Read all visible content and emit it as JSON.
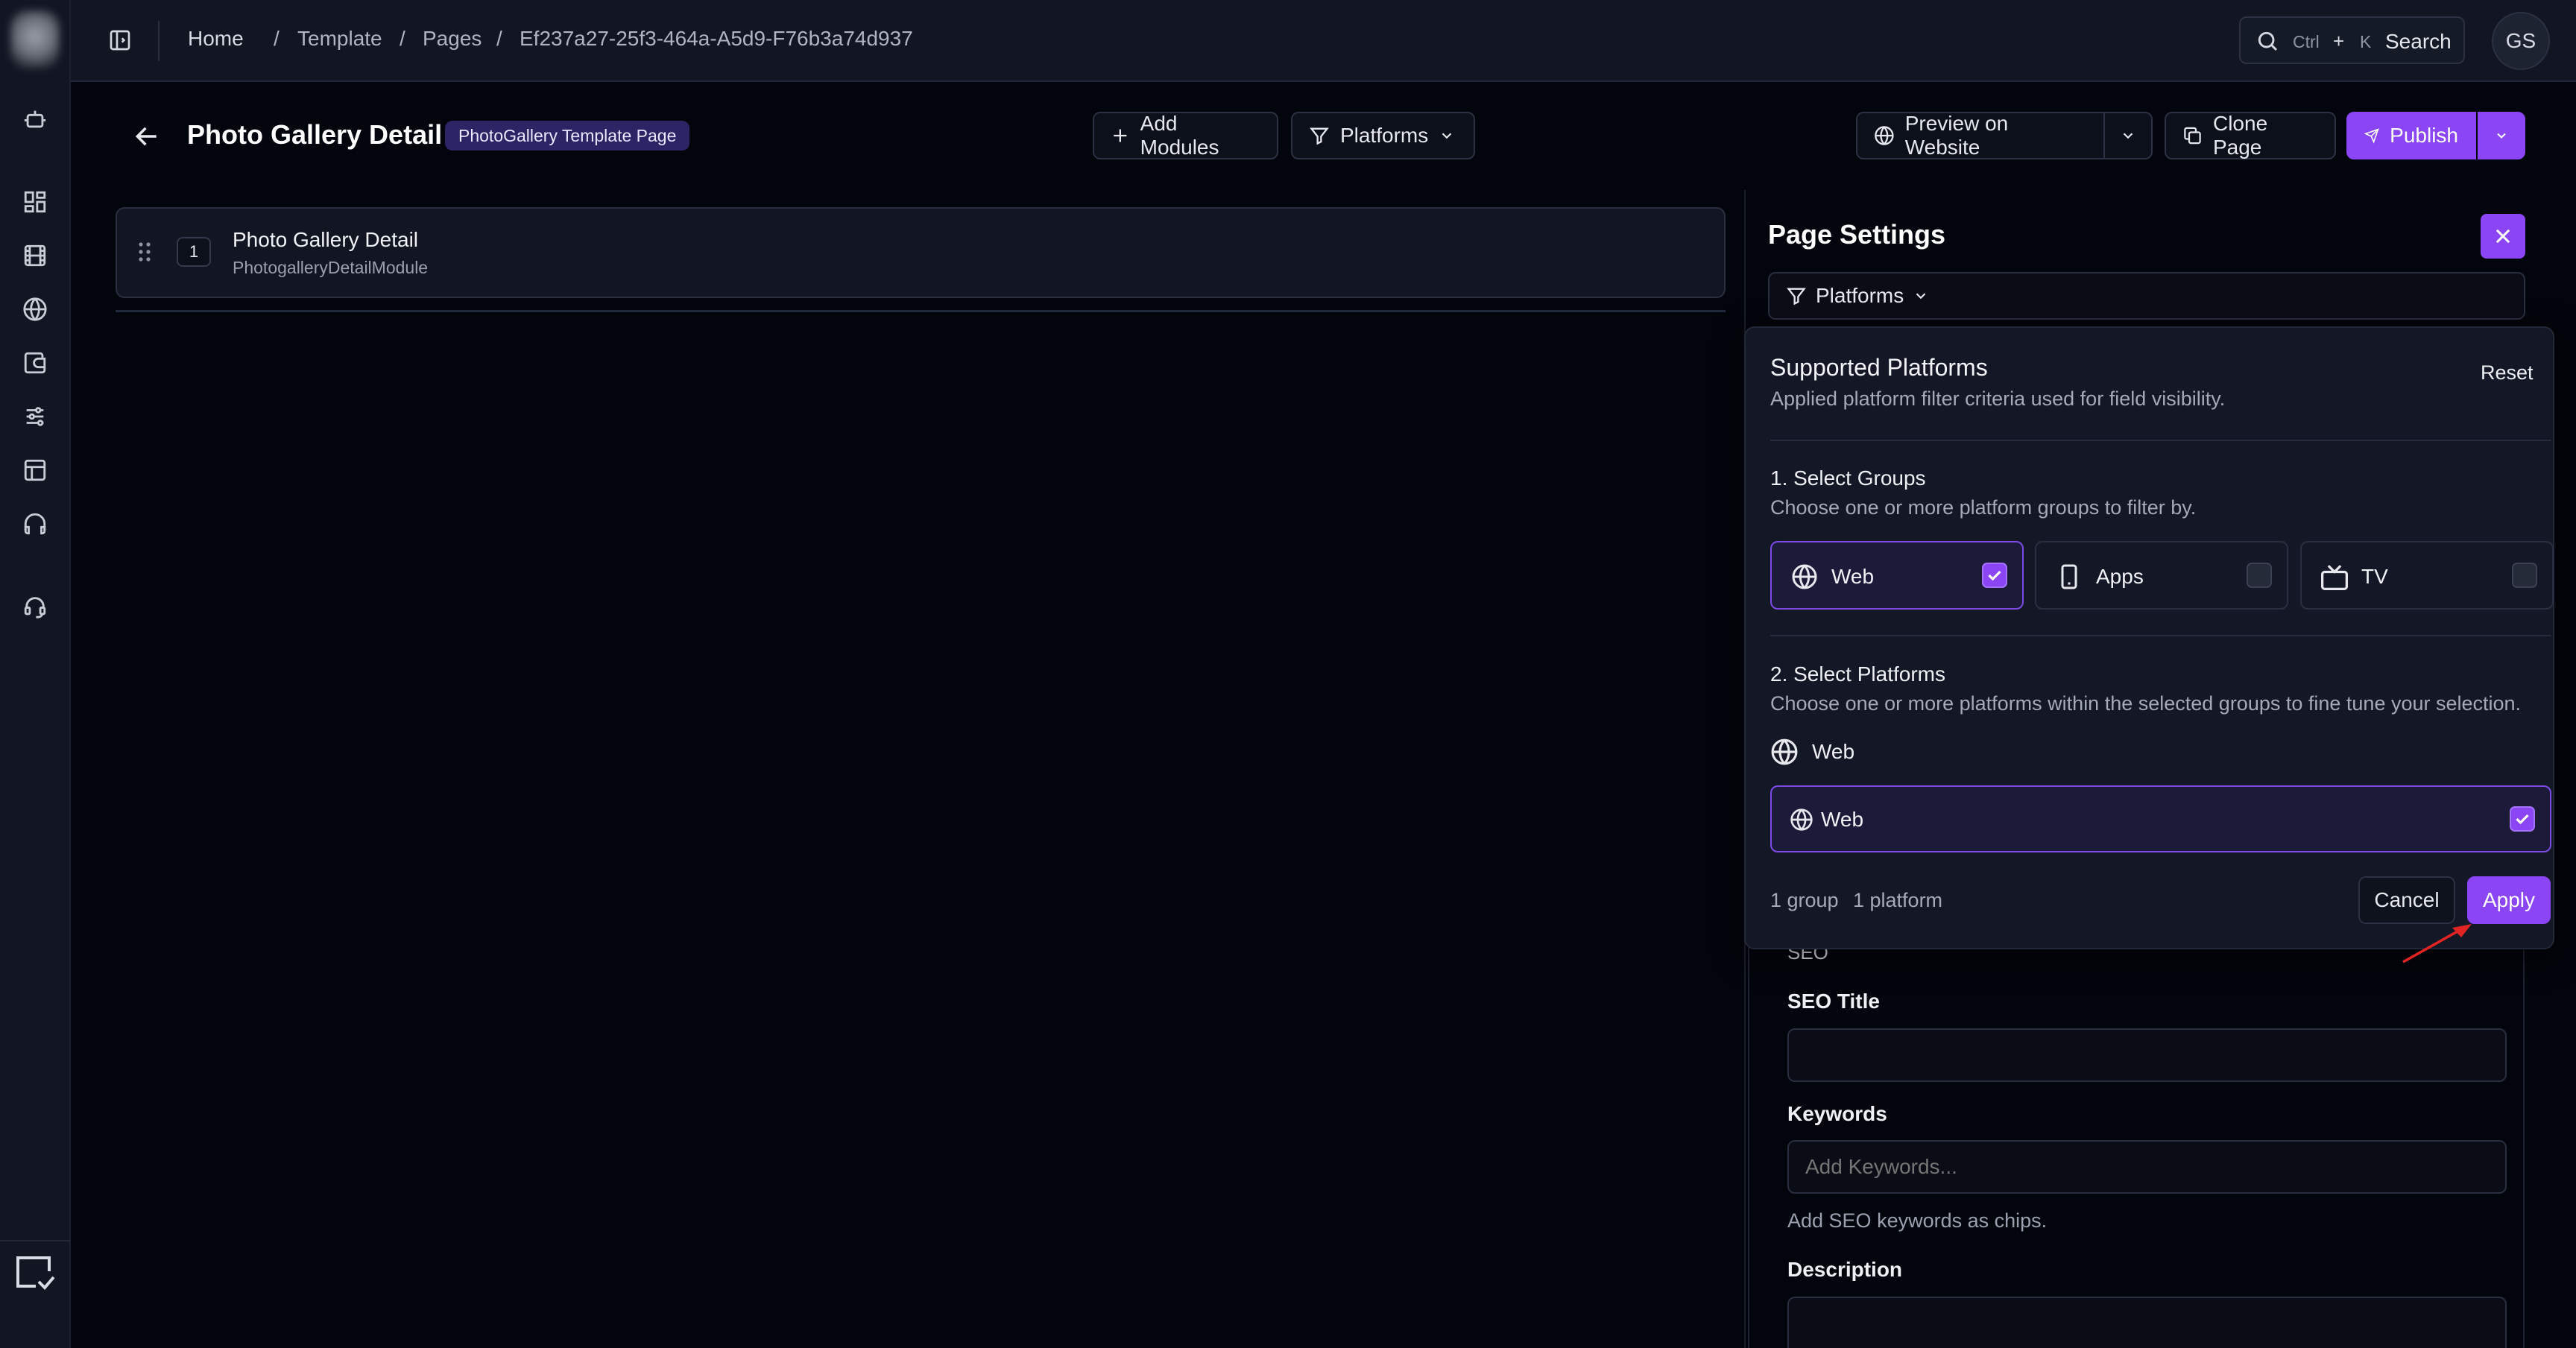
{
  "breadcrumbs": [
    "Home",
    "Template",
    "Pages",
    "Ef237a27-25f3-464a-A5d9-F76b3a74d937"
  ],
  "search": {
    "key1": "Ctrl",
    "plus": "+",
    "key2": "K",
    "label": "Search"
  },
  "user": {
    "initials": "GS"
  },
  "page": {
    "title": "Photo Gallery Detail",
    "badge": "PhotoGallery Template Page"
  },
  "toolbar": {
    "add_modules": "Add Modules",
    "platforms": "Platforms",
    "preview": "Preview on Website",
    "clone": "Clone Page",
    "publish": "Publish"
  },
  "module": {
    "index": "1",
    "title": "Photo Gallery Detail",
    "subtitle": "PhotogalleryDetailModule"
  },
  "settings": {
    "title": "Page Settings",
    "platforms_filter": "Platforms",
    "seo_section": "SEO",
    "seo_title_label": "SEO Title",
    "seo_title_value": "",
    "keywords_label": "Keywords",
    "keywords_placeholder": "Add Keywords...",
    "keywords_help": "Add SEO keywords as chips.",
    "description_label": "Description"
  },
  "popover": {
    "title": "Supported Platforms",
    "subtitle": "Applied platform filter criteria used for field visibility.",
    "reset": "Reset",
    "groups_title": "1. Select Groups",
    "groups_subtitle": "Choose one or more platform groups to filter by.",
    "groups": [
      {
        "label": "Web",
        "checked": true
      },
      {
        "label": "Apps",
        "checked": false
      },
      {
        "label": "TV",
        "checked": false
      }
    ],
    "platforms_title": "2. Select Platforms",
    "platforms_subtitle": "Choose one or more platforms within the selected groups to fine tune your selection.",
    "platform_group_label": "Web",
    "platform_option": {
      "label": "Web",
      "checked": true
    },
    "summary_groups": "1 group",
    "summary_platforms": "1 platform",
    "cancel": "Cancel",
    "apply": "Apply"
  },
  "colors": {
    "accent": "#8b45f5",
    "background": "#03050c",
    "surface": "#121623",
    "annotation_arrow": "#e02424"
  }
}
